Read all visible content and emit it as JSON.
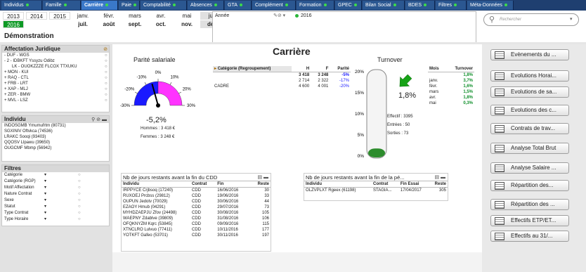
{
  "tabs": [
    {
      "label": "Individus",
      "active": false
    },
    {
      "label": "Famille",
      "active": false
    },
    {
      "label": "Carrière",
      "active": true
    },
    {
      "label": "Paie",
      "active": false
    },
    {
      "label": "Comptabilité",
      "active": false
    },
    {
      "label": "Absences",
      "active": false
    },
    {
      "label": "GTA",
      "active": false
    },
    {
      "label": "Complément",
      "active": false
    },
    {
      "label": "Formation",
      "active": false
    },
    {
      "label": "GPEC",
      "active": false
    },
    {
      "label": "Bilan Social",
      "active": false
    },
    {
      "label": "BDES",
      "active": false
    },
    {
      "label": "Filtres",
      "active": false
    },
    {
      "label": "Méta-Données",
      "active": false
    }
  ],
  "years": [
    "2013",
    "2014",
    "2015",
    "2016"
  ],
  "selected_year": "2016",
  "months": [
    [
      "janv.",
      "févr.",
      "mars",
      "avr.",
      "mai",
      "juin"
    ],
    [
      "juil.",
      "août",
      "sept.",
      "oct.",
      "nov.",
      "déc."
    ]
  ],
  "company": "Démonstration",
  "selection": {
    "label": "Année",
    "value": "2016"
  },
  "search": {
    "placeholder": "Rechercher"
  },
  "page_title": "Carrière",
  "legal": {
    "title": "Affectation Juridique",
    "items": [
      "- DUF - WGS",
      "- 2 - IDBKFT Yssyzu Odibz",
      "LK - OUOKZZZE FLCOX TTXUKU",
      "+ MON - KUI",
      "+ RAQ - CTL",
      "+ FRB - LRT",
      "+ XAP - MLJ",
      "+ ZER - BMW",
      "+ MVL - LSZ"
    ]
  },
  "individu": {
    "title": "Individu",
    "items": [
      "INDOSGMB Ymumufrtm (80731)",
      "SGXINIV Oftvkca (74536)",
      "LRAKC Sooqi (93403)",
      "QQOSV Llpawu (39650)",
      "OUGCMF Mbmp (56942)"
    ]
  },
  "filters": {
    "title": "Filtres",
    "items": [
      "Catégorie",
      "Catégorie (RGP)",
      "Motif Affectation",
      "Nature Contrat",
      "Sexe",
      "Statut",
      "Type Contrat",
      "Type Horaire"
    ]
  },
  "gauge": {
    "title": "Parité salariale",
    "value": "-5,2%",
    "ticks": [
      "-30%",
      "-20%",
      "-10%",
      "0%",
      "10%",
      "20%",
      "30%"
    ],
    "hommes": "Hommes : 3 418 €",
    "femmes": "Femmes : 3 248 €"
  },
  "category_table": {
    "headers": [
      "Catégorie (Regroupement)",
      "H",
      "F",
      "Parité"
    ],
    "total": [
      "",
      "3 418",
      "3 248",
      "-5%"
    ],
    "rows": [
      [
        "",
        "2 714",
        "2 322",
        "-17%"
      ],
      [
        "CADRE",
        "4 600",
        "4 001",
        "-20%"
      ]
    ]
  },
  "turnover": {
    "title": "Turnover",
    "value": "1,8%",
    "axis": [
      "20%",
      "15%",
      "10%",
      "5%",
      "0%"
    ],
    "effectif": "Effectif : 3395",
    "entrees": "Entrées : 50",
    "sorties": "Sorties : 73",
    "level": 0.09
  },
  "monthly": {
    "headers": [
      "Mois",
      "Turnover"
    ],
    "rows": [
      [
        "",
        "1,8%"
      ],
      [
        "janv.",
        "3,7%"
      ],
      [
        "févr.",
        "1,6%"
      ],
      [
        "mars",
        "1,5%"
      ],
      [
        "avr.",
        "1,8%"
      ],
      [
        "mai",
        "0,3%"
      ]
    ]
  },
  "cdd": {
    "title": "Nb de jours restants avant la fin du CDD",
    "headers": [
      "Individu",
      "Contrat",
      "Fin",
      "Reste"
    ],
    "rows": [
      [
        "IRPPYCE Crjbsoq (17240)",
        "CDD",
        "16/06/2016",
        "30"
      ],
      [
        "RUXOEJ Prcbss (29812)",
        "CDD",
        "19/06/2016",
        "33"
      ],
      [
        "OUPUN Jedotv (70029)",
        "CDD",
        "30/06/2016",
        "44"
      ],
      [
        "EZAOY Hmub (04291)",
        "CDD",
        "29/07/2016",
        "73"
      ],
      [
        "MYHDZAEPJU Zfov (24498)",
        "CDD",
        "30/08/2016",
        "105"
      ],
      [
        "WAEPNY Zdablve (39809)",
        "CDD",
        "31/08/2016",
        "106"
      ],
      [
        "OFQKNYZM Kqrc (53845)",
        "CDD",
        "09/09/2016",
        "115"
      ],
      [
        "XTNCLRO Lulvuo (77411)",
        "CDD",
        "10/11/2016",
        "177"
      ],
      [
        "YOTKFT Gafeo (53701)",
        "CDD",
        "30/11/2016",
        "197"
      ]
    ]
  },
  "essai": {
    "title": "Nb de jours restants avant la fin de la pé...",
    "headers": [
      "Individu",
      "Contrat",
      "Fin Essai",
      "Reste"
    ],
    "rows": [
      [
        "OLZVPLXT Rgeex (61198)",
        "STAGIA...",
        "17/04/2017",
        "305"
      ]
    ]
  },
  "buttons": [
    "Evènements du ...",
    "Evolutions Horai...",
    "Evolutions de sa...",
    "Evolutions des c...",
    "Contrats de trav...",
    "Analyse Total Brut",
    "Analyse Salaire ...",
    "Répartition des...",
    "Répartition des ...",
    "Effectifs ETP/ET...",
    "Effectifs au 31/..."
  ],
  "colors": {
    "tab_bg": "#2b5791",
    "tab_active": "#3a78c9",
    "year_selected": "#0e9a25",
    "hommes": "#1a1aff",
    "femmes": "#ff33ff",
    "turnover_arrow": "#16a316"
  }
}
